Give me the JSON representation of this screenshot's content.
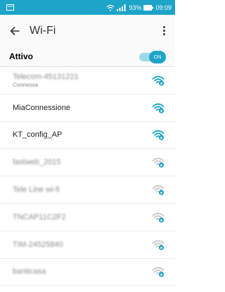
{
  "status_bar": {
    "battery_text": "93%",
    "time": "09:09"
  },
  "app_bar": {
    "title": "Wi-Fi"
  },
  "toggle": {
    "label": "Attivo",
    "state_text": "ON"
  },
  "networks": [
    {
      "name": "Telecom-45131221",
      "status": "Connessa",
      "signal": "strong",
      "locked": true
    },
    {
      "name": "MiaConnessione",
      "status": "",
      "signal": "strong",
      "locked": true
    },
    {
      "name": "KT_config_AP",
      "status": "",
      "signal": "strong",
      "locked": true
    },
    {
      "name": "fastweb_2015",
      "status": "",
      "signal": "weak",
      "locked": true
    },
    {
      "name": "Tele Line wi-fi",
      "status": "",
      "signal": "weak",
      "locked": true
    },
    {
      "name": "TNCAP11C2F2",
      "status": "",
      "signal": "weak",
      "locked": true
    },
    {
      "name": "TIM-24525840",
      "status": "",
      "signal": "weak",
      "locked": true
    },
    {
      "name": "banticasa",
      "status": "",
      "signal": "weak",
      "locked": true
    }
  ],
  "colors": {
    "accent": "#1ea4c8",
    "signal_strong": "#1ea4c8",
    "signal_weak": "#c8c8c8"
  }
}
